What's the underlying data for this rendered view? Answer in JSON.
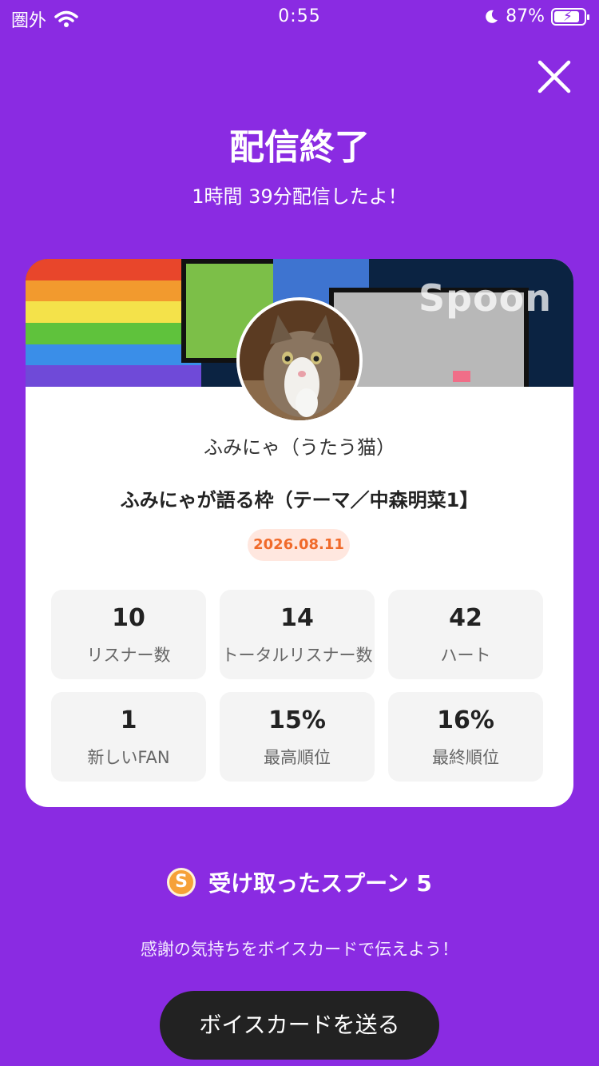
{
  "status_bar": {
    "carrier": "圏外",
    "time": "0:55",
    "battery_percent": "87%",
    "battery_level": 0.87
  },
  "header": {
    "title": "配信終了",
    "subtitle": "1時間 39分配信したよ！"
  },
  "card": {
    "banner_logo": "Spoon",
    "nickname": "ふみにゃ（うたう猫）",
    "live_title": "ふみにゃが語る枠（テーマ／中森明菜1】",
    "date": "2026.08.11",
    "stats": [
      {
        "value": "10",
        "label": "リスナー数"
      },
      {
        "value": "14",
        "label": "トータルリスナー数"
      },
      {
        "value": "42",
        "label": "ハート"
      },
      {
        "value": "1",
        "label": "新しいFAN"
      },
      {
        "value": "15%",
        "label": "最高順位"
      },
      {
        "value": "16%",
        "label": "最終順位"
      }
    ]
  },
  "spoon": {
    "icon_letter": "S",
    "text": "受け取ったスプーン  5"
  },
  "thanks_text": "感謝の気持ちをボイスカードで伝えよう！",
  "voice_card_button": "ボイスカードを送る",
  "colors": {
    "background": "#8a2be2",
    "date_badge_text": "#f06a2a",
    "button_bg": "#222222"
  }
}
